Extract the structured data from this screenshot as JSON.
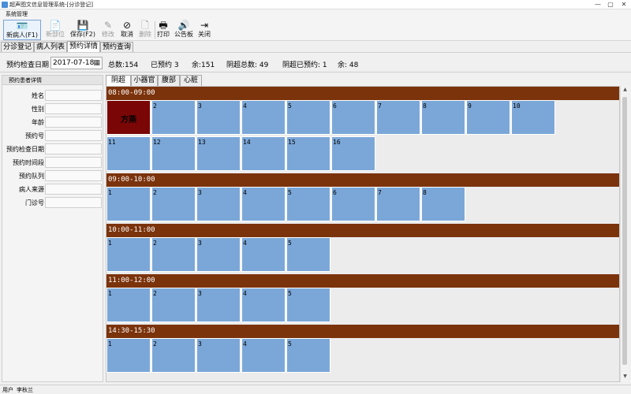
{
  "window": {
    "title": "超声图文信息管理系统-[分诊登记]",
    "minimize": "—",
    "maximize": "▢",
    "close": "✕"
  },
  "menu": {
    "items": [
      "系统管理"
    ]
  },
  "toolbar": {
    "buttons": [
      {
        "id": "new-patient",
        "label": "新病人(F1)",
        "icon": "person-card-icon",
        "glyph": "🪪",
        "enabled": true
      },
      {
        "id": "new-part",
        "label": "新部位",
        "icon": "add-document-icon",
        "glyph": "📄",
        "enabled": false
      },
      {
        "id": "save",
        "label": "保存(F2)",
        "icon": "floppy-disk-icon",
        "glyph": "💾",
        "enabled": true
      },
      {
        "id": "edit",
        "label": "修改",
        "icon": "edit-icon",
        "glyph": "✎",
        "enabled": false
      },
      {
        "id": "cancel",
        "label": "取消",
        "icon": "cancel-icon",
        "glyph": "⊘",
        "enabled": true
      },
      {
        "id": "delete",
        "label": "删除",
        "icon": "delete-icon",
        "glyph": "🗋",
        "enabled": false
      },
      {
        "id": "print",
        "label": "打印",
        "icon": "printer-icon",
        "glyph": "🖶",
        "enabled": true
      },
      {
        "id": "announce",
        "label": "公告板",
        "icon": "speaker-icon",
        "glyph": "🔊",
        "enabled": true
      },
      {
        "id": "close",
        "label": "关闭",
        "icon": "exit-icon",
        "glyph": "⇥",
        "enabled": true
      }
    ]
  },
  "main_tabs": [
    {
      "label": "分诊登记",
      "active": false
    },
    {
      "label": "病人列表",
      "active": false
    },
    {
      "label": "预约详情",
      "active": true
    },
    {
      "label": "预约查询",
      "active": false
    }
  ],
  "filter": {
    "date_label": "预约检查日期",
    "date_value": "2017-07-18",
    "calendar_icon": "calendar-icon",
    "stats": {
      "total": "总数:154",
      "booked": "已预约 3",
      "remaining": "余:151",
      "overbook_total": "阴超总数: 49",
      "overbook_booked": "阴超已预约: 1",
      "overbook_remaining": "余: 48"
    }
  },
  "patient_panel": {
    "header": "预约患者详情",
    "fields": [
      {
        "label": "姓名",
        "value": ""
      },
      {
        "label": "性别",
        "value": ""
      },
      {
        "label": "年龄",
        "value": ""
      },
      {
        "label": "预约号",
        "value": ""
      },
      {
        "label": "预约检查日期",
        "value": ""
      },
      {
        "label": "预约时间段",
        "value": ""
      },
      {
        "label": "预约队列",
        "value": ""
      },
      {
        "label": "病人来源",
        "value": ""
      },
      {
        "label": "门诊号",
        "value": ""
      }
    ]
  },
  "sub_tabs": [
    {
      "label": "阴超",
      "active": true
    },
    {
      "label": "小器官",
      "active": false
    },
    {
      "label": "腹部",
      "active": false
    },
    {
      "label": "心脏",
      "active": false
    }
  ],
  "slots": [
    {
      "time": "08:00-09:00",
      "cells": [
        {
          "num": "",
          "patient": "方燕"
        },
        {
          "num": "2"
        },
        {
          "num": "3"
        },
        {
          "num": "4"
        },
        {
          "num": "5"
        },
        {
          "num": "6"
        },
        {
          "num": "7"
        },
        {
          "num": "8"
        },
        {
          "num": "9"
        },
        {
          "num": "10"
        },
        {
          "num": "11"
        },
        {
          "num": "12"
        },
        {
          "num": "13"
        },
        {
          "num": "14"
        },
        {
          "num": "15"
        },
        {
          "num": "16"
        }
      ]
    },
    {
      "time": "09:00-10:00",
      "cells": [
        {
          "num": "1"
        },
        {
          "num": "2"
        },
        {
          "num": "3"
        },
        {
          "num": "4"
        },
        {
          "num": "5"
        },
        {
          "num": "6"
        },
        {
          "num": "7"
        },
        {
          "num": "8"
        }
      ]
    },
    {
      "time": "10:00-11:00",
      "cells": [
        {
          "num": "1"
        },
        {
          "num": "2"
        },
        {
          "num": "3"
        },
        {
          "num": "4"
        },
        {
          "num": "5"
        }
      ]
    },
    {
      "time": "11:00-12:00",
      "cells": [
        {
          "num": "1"
        },
        {
          "num": "2"
        },
        {
          "num": "3"
        },
        {
          "num": "4"
        },
        {
          "num": "5"
        }
      ]
    },
    {
      "time": "14:30-15:30",
      "cells": [
        {
          "num": "1"
        },
        {
          "num": "2"
        },
        {
          "num": "3"
        },
        {
          "num": "4"
        },
        {
          "num": "5"
        }
      ]
    }
  ],
  "status": {
    "user_label": "用户",
    "user_name": "李秋兰"
  },
  "colors": {
    "slot_header": "#7b330c",
    "cell_free": "#7ba7d8",
    "cell_taken": "#7a0606"
  }
}
